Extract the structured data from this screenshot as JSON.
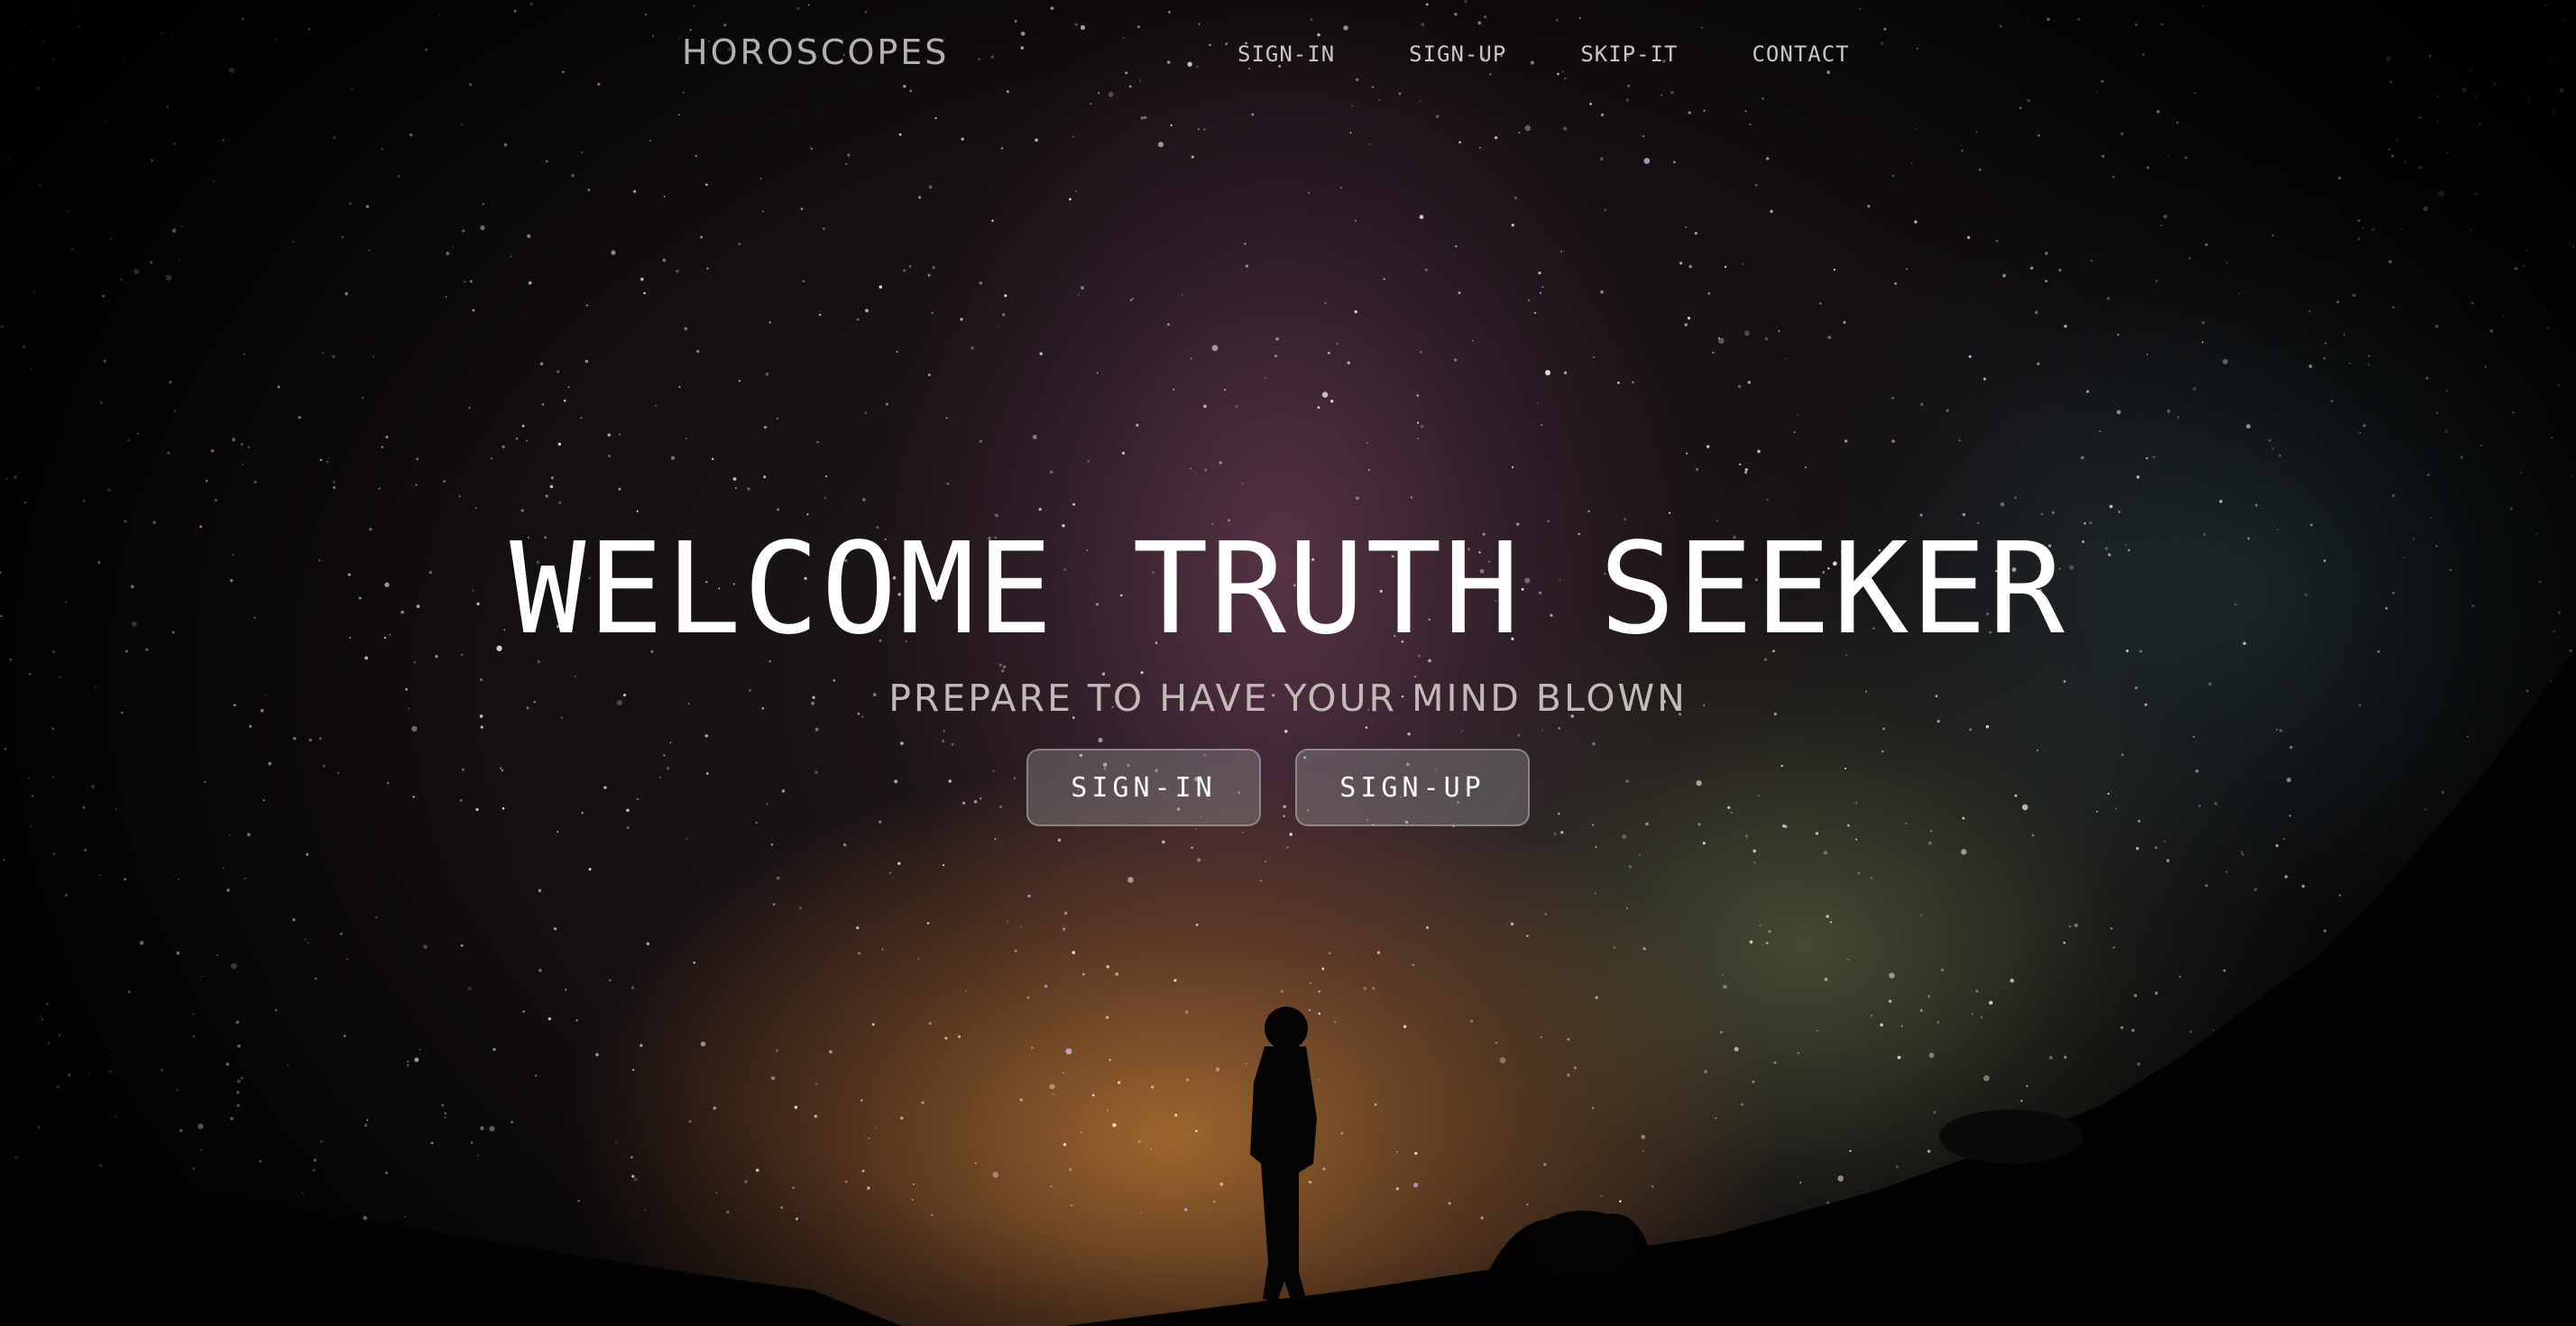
{
  "brand": "HOROSCOPES",
  "nav": {
    "items": [
      {
        "label": "SIGN-IN"
      },
      {
        "label": "SIGN-UP"
      },
      {
        "label": "SKIP-IT"
      },
      {
        "label": "CONTACT"
      }
    ]
  },
  "hero": {
    "title": "WELCOME TRUTH SEEKER",
    "subtitle": "PREPARE TO HAVE YOUR MIND BLOWN",
    "buttons": [
      {
        "label": "SIGN-IN"
      },
      {
        "label": "SIGN-UP"
      }
    ]
  },
  "background": {
    "image": "night-sky-milky-way-person-silhouette"
  }
}
